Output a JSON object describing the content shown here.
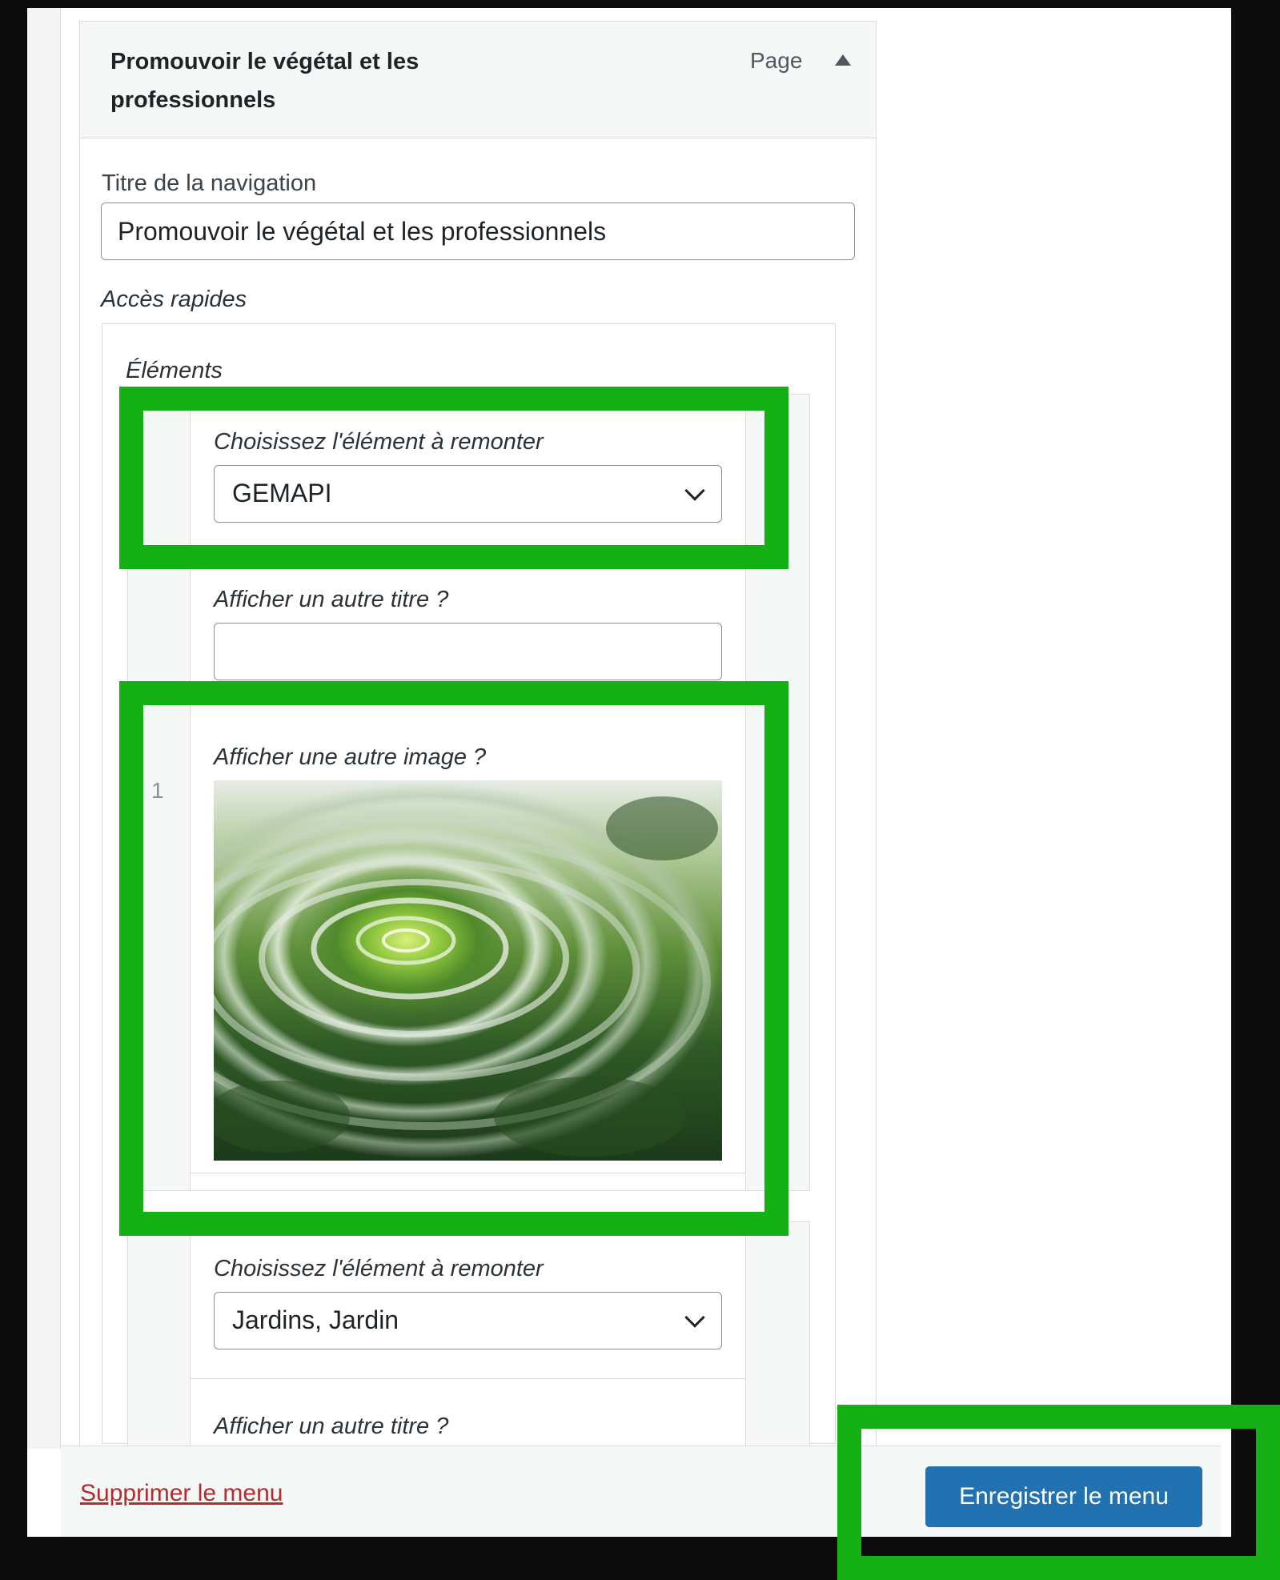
{
  "menu_item": {
    "title": "Promouvoir le végétal et les professionnels",
    "type": "Page",
    "nav_title_label": "Titre de la navigation",
    "nav_title_value": "Promouvoir le végétal et les professionnels"
  },
  "quick_access": {
    "label": "Accès rapides",
    "elements_label": "Éléments",
    "rows": [
      {
        "number": "1",
        "choose_label": "Choisissez l'élément à remonter",
        "selected": "GEMAPI",
        "alt_title_label": "Afficher un autre titre ?",
        "alt_title_value": "",
        "alt_image_label": "Afficher une autre image ?"
      },
      {
        "choose_label": "Choisissez l'élément à remonter",
        "selected": "Jardins, Jardin",
        "alt_title_label": "Afficher un autre titre ?"
      }
    ]
  },
  "footer": {
    "delete_label": "Supprimer le menu",
    "save_label": "Enregistrer le menu"
  },
  "colors": {
    "highlight": "#15b015",
    "primary_button": "#2271b1",
    "delete_link": "#b32d2e"
  },
  "icons": {
    "toggle": "triangle-up-icon",
    "select_arrow": "chevron-down-icon"
  }
}
